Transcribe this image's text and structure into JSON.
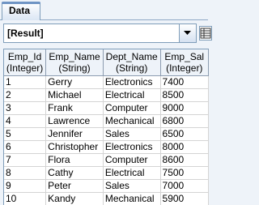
{
  "tab": {
    "label": "Data"
  },
  "result_select": {
    "value": "[Result]"
  },
  "columns": [
    {
      "name": "Emp_Id",
      "type": "(Integer)"
    },
    {
      "name": "Emp_Name",
      "type": "(String)"
    },
    {
      "name": "Dept_Name",
      "type": "(String)"
    },
    {
      "name": "Emp_Sal",
      "type": "(Integer)"
    }
  ],
  "rows": [
    [
      "1",
      "Gerry",
      "Electronics",
      "7400"
    ],
    [
      "2",
      "Michael",
      "Electrical",
      "8500"
    ],
    [
      "3",
      "Frank",
      "Computer",
      "9000"
    ],
    [
      "4",
      "Lawrence",
      "Mechanical",
      "6800"
    ],
    [
      "5",
      "Jennifer",
      "Sales",
      "6500"
    ],
    [
      "6",
      "Christopher",
      "Electronics",
      "8000"
    ],
    [
      "7",
      "Flora",
      "Computer",
      "8600"
    ],
    [
      "8",
      "Cathy",
      "Electrical",
      "7500"
    ],
    [
      "9",
      "Peter",
      "Sales",
      "7000"
    ],
    [
      "10",
      "Kandy",
      "Mechanical",
      "5900"
    ]
  ],
  "icons": {
    "dropdown": "chevron-down-icon",
    "grid": "table-grid-icon"
  }
}
